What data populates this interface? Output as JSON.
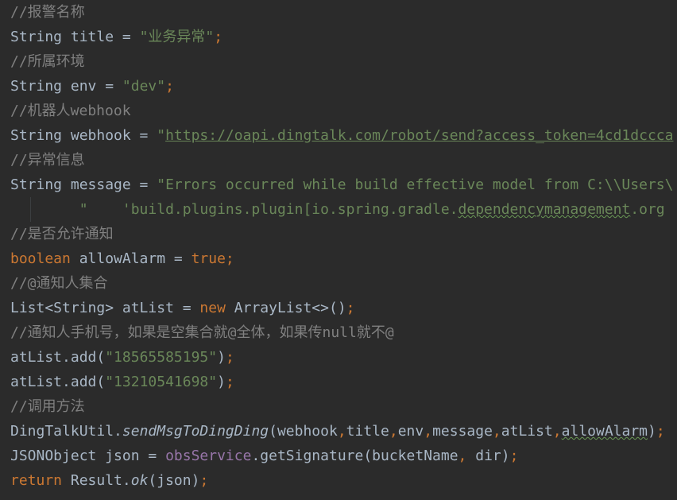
{
  "lines": [
    {
      "segments": [
        {
          "t": "//报警名称",
          "c": "cm"
        }
      ]
    },
    {
      "segments": [
        {
          "t": "String title = "
        },
        {
          "t": "\"业务异常\"",
          "c": "st"
        },
        {
          "t": ";",
          "c": "kw"
        }
      ]
    },
    {
      "segments": [
        {
          "t": "//所属环境",
          "c": "cm"
        }
      ]
    },
    {
      "segments": [
        {
          "t": "String env = "
        },
        {
          "t": "\"dev\"",
          "c": "st"
        },
        {
          "t": ";",
          "c": "kw"
        }
      ]
    },
    {
      "segments": [
        {
          "t": "//机器人webhook",
          "c": "cm"
        }
      ]
    },
    {
      "segments": [
        {
          "t": "String webhook = "
        },
        {
          "t": "\"",
          "c": "st"
        },
        {
          "t": "https://oapi.dingtalk.com/robot/send?access_token=4cd1dccca",
          "c": "st link"
        }
      ]
    },
    {
      "segments": [
        {
          "t": "//异常信息",
          "c": "cm"
        }
      ]
    },
    {
      "segments": [
        {
          "t": "String message = "
        },
        {
          "t": "\"Errors occurred while build effective model from C:\\\\Users\\",
          "c": "st"
        }
      ]
    },
    {
      "segments": [
        {
          "t": "        \"    'build.plugins.plugin[io.spring.gradle.",
          "c": "st"
        },
        {
          "t": "dependencymanagement",
          "c": "st wavy"
        },
        {
          "t": ".org",
          "c": "st"
        }
      ]
    },
    {
      "segments": [
        {
          "t": "//是否允许通知",
          "c": "cm"
        }
      ]
    },
    {
      "segments": [
        {
          "t": "boolean",
          "c": "kw"
        },
        {
          "t": " allowAlarm = "
        },
        {
          "t": "true;",
          "c": "kw"
        }
      ]
    },
    {
      "segments": [
        {
          "t": "//@通知人集合",
          "c": "cm"
        }
      ]
    },
    {
      "segments": [
        {
          "t": "List<String> atList = "
        },
        {
          "t": "new",
          "c": "kw"
        },
        {
          "t": " ArrayList<>()"
        },
        {
          "t": ";",
          "c": "kw"
        }
      ]
    },
    {
      "segments": [
        {
          "t": "//通知人手机号，如果是空集合就@全体，如果传null就不@",
          "c": "cm"
        }
      ]
    },
    {
      "segments": [
        {
          "t": "atList.add("
        },
        {
          "t": "\"18565585195\"",
          "c": "st"
        },
        {
          "t": ")"
        },
        {
          "t": ";",
          "c": "kw"
        }
      ]
    },
    {
      "segments": [
        {
          "t": "atList.add("
        },
        {
          "t": "\"13210541698\"",
          "c": "st"
        },
        {
          "t": ")"
        },
        {
          "t": ";",
          "c": "kw"
        }
      ]
    },
    {
      "segments": [
        {
          "t": "//调用方法",
          "c": "cm"
        }
      ]
    },
    {
      "segments": [
        {
          "t": "DingTalkUtil."
        },
        {
          "t": "sendMsgToDingDing",
          "c": "fn"
        },
        {
          "t": "(webhook"
        },
        {
          "t": ",",
          "c": "kw"
        },
        {
          "t": "title"
        },
        {
          "t": ",",
          "c": "kw"
        },
        {
          "t": "env"
        },
        {
          "t": ",",
          "c": "kw"
        },
        {
          "t": "message"
        },
        {
          "t": ",",
          "c": "kw"
        },
        {
          "t": "atList"
        },
        {
          "t": ",",
          "c": "kw"
        },
        {
          "t": "allowAlarm",
          "c": "wavy"
        },
        {
          "t": ")"
        },
        {
          "t": ";",
          "c": "kw"
        }
      ]
    },
    {
      "segments": [
        {
          "t": "JSONObject json = "
        },
        {
          "t": "obsService",
          "c": "fld"
        },
        {
          "t": ".getSignature(bucketName"
        },
        {
          "t": ",",
          "c": "kw"
        },
        {
          "t": " dir)"
        },
        {
          "t": ";",
          "c": "kw"
        }
      ]
    },
    {
      "segments": [
        {
          "t": "return",
          "c": "kw"
        },
        {
          "t": " Result."
        },
        {
          "t": "ok",
          "c": "fn"
        },
        {
          "t": "(json)"
        },
        {
          "t": ";",
          "c": "kw"
        }
      ]
    }
  ]
}
